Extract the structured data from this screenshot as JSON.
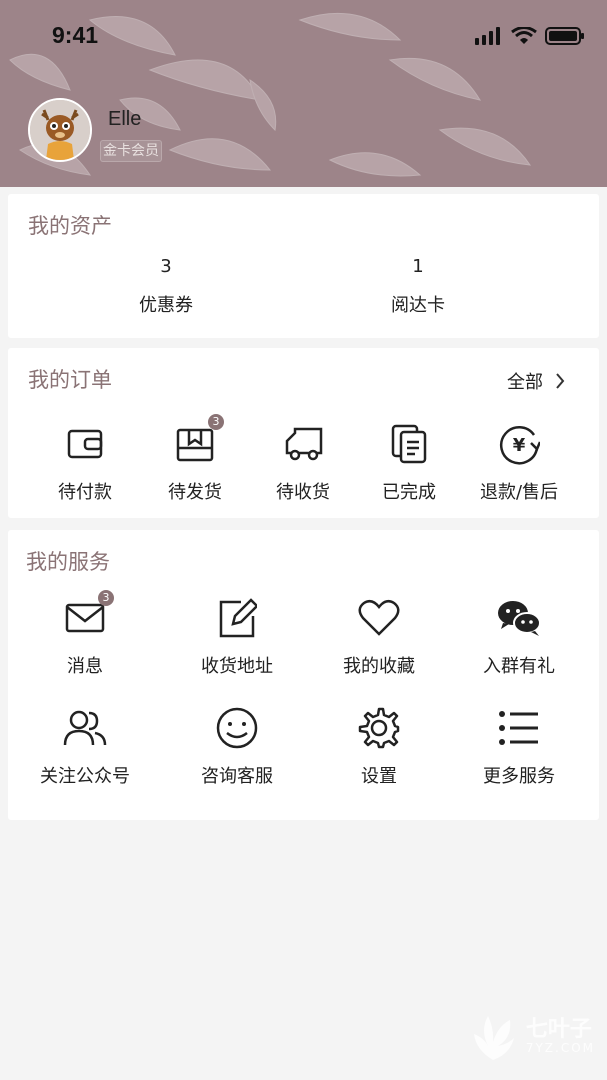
{
  "status_bar": {
    "time": "9:41"
  },
  "profile": {
    "username": "Elle",
    "member_level": "金卡会员"
  },
  "assets": {
    "title": "我的资产",
    "items": [
      {
        "value": "3",
        "label": "优惠券"
      },
      {
        "value": "1",
        "label": "阅达卡"
      }
    ]
  },
  "orders": {
    "title": "我的订单",
    "see_all": "全部",
    "items": [
      {
        "label": "待付款",
        "icon": "wallet-icon"
      },
      {
        "label": "待发货",
        "icon": "box-icon",
        "badge": "3"
      },
      {
        "label": "待收货",
        "icon": "truck-icon"
      },
      {
        "label": "已完成",
        "icon": "document-icon"
      },
      {
        "label": "退款/售后",
        "icon": "refund-icon"
      }
    ]
  },
  "services": {
    "title": "我的服务",
    "items": [
      {
        "label": "消息",
        "icon": "mail-icon",
        "badge": "3"
      },
      {
        "label": "收货地址",
        "icon": "edit-icon"
      },
      {
        "label": "我的收藏",
        "icon": "heart-icon"
      },
      {
        "label": "入群有礼",
        "icon": "wechat-icon"
      },
      {
        "label": "关注公众号",
        "icon": "users-icon"
      },
      {
        "label": "咨询客服",
        "icon": "smile-icon"
      },
      {
        "label": "设置",
        "icon": "gear-icon"
      },
      {
        "label": "更多服务",
        "icon": "list-icon"
      }
    ]
  },
  "watermark": {
    "text": "七叶子",
    "sub": "7YZ.COM"
  },
  "colors": {
    "header_bg": "#9d8489",
    "accent": "#8a7375",
    "page_bg": "#f4f4f4"
  }
}
